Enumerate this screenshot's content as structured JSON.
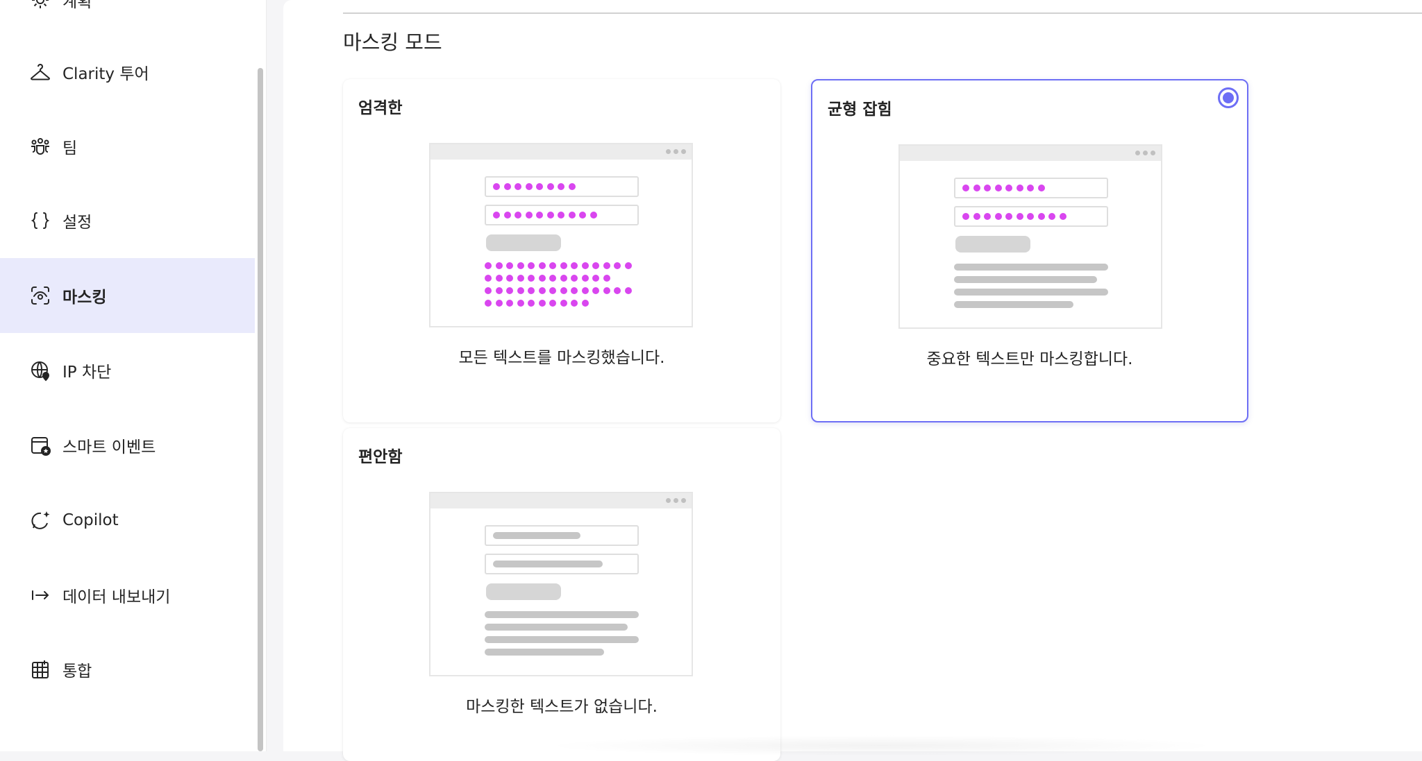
{
  "sidebar": {
    "items": [
      {
        "label": "계획",
        "icon": "gear-icon"
      },
      {
        "label": "Clarity 투어",
        "icon": "hanger-icon"
      },
      {
        "label": "팀",
        "icon": "people-team-icon"
      },
      {
        "label": "설정",
        "icon": "braces-icon"
      },
      {
        "label": "마스킹",
        "icon": "eye-focus-icon",
        "active": true
      },
      {
        "label": "IP 차단",
        "icon": "globe-location-icon"
      },
      {
        "label": "스마트 이벤트",
        "icon": "calendar-star-icon"
      },
      {
        "label": "Copilot",
        "icon": "chat-sparkle-icon"
      },
      {
        "label": "데이터 내보내기",
        "icon": "arrow-export-icon"
      },
      {
        "label": "통합",
        "icon": "grid-table-icon"
      }
    ]
  },
  "main": {
    "section_title": "마스킹 모드",
    "cards": [
      {
        "title": "엄격한",
        "caption": "모든 텍스트를 마스킹했습니다.",
        "mode": "strict",
        "selected": false
      },
      {
        "title": "균형 잡힘",
        "caption": "중요한 텍스트만 마스킹합니다.",
        "mode": "balanced",
        "selected": true
      },
      {
        "title": "편안함",
        "caption": "마스킹한 텍스트가 없습니다.",
        "mode": "relaxed",
        "selected": false
      }
    ]
  },
  "colors": {
    "accent": "#6d6ef5",
    "active_nav_bg": "#e9eafc",
    "mask_dot": "#d946ef",
    "placeholder_gray": "#c6c6c6"
  }
}
